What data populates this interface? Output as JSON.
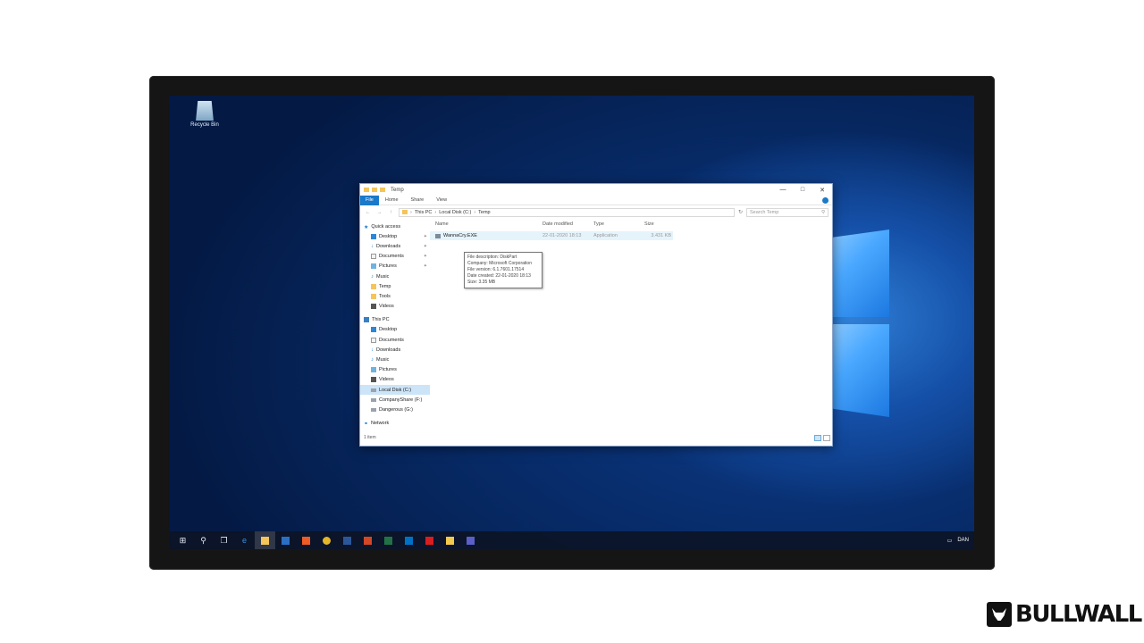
{
  "desktop": {
    "recycle_bin_label": "Recycle Bin"
  },
  "explorer": {
    "title": "Temp",
    "window_controls": {
      "minimize": "—",
      "maximize": "□",
      "close": "✕"
    },
    "ribbon": {
      "file": "File",
      "home": "Home",
      "share": "Share",
      "view": "View"
    },
    "nav_buttons": {
      "back": "←",
      "forward": "→",
      "up": "↑"
    },
    "address": {
      "this_pc": "This PC",
      "local_disk": "Local Disk (C:)",
      "temp": "Temp",
      "separator": "›"
    },
    "search_placeholder": "Search Temp",
    "nav_pane": {
      "quick_access": "Quick access",
      "quick_items": [
        "Desktop",
        "Downloads",
        "Documents",
        "Pictures",
        "Music",
        "Temp",
        "Tools",
        "Videos"
      ],
      "this_pc": "This PC",
      "pc_items": [
        "Desktop",
        "Documents",
        "Downloads",
        "Music",
        "Pictures",
        "Videos",
        "Local Disk (C:)",
        "CompanyShare (F:)",
        "Dangerous (G:)"
      ],
      "network": "Network"
    },
    "columns": {
      "name": "Name",
      "date_modified": "Date modified",
      "type": "Type",
      "size": "Size"
    },
    "files": [
      {
        "name": "WannaCry.EXE",
        "date_modified": "22-01-2020 18:13",
        "type": "Application",
        "size": "3.431 KB"
      }
    ],
    "tooltip": {
      "description": "File description: DiskPart",
      "company": "Company: Microsoft Corporation",
      "version": "File version: 6.1.7601.17514",
      "created": "Date created: 22-01-2020 18:13",
      "size": "Size: 3.35 MB"
    },
    "status": "1 item"
  },
  "taskbar": {
    "tray_text": "DAN"
  },
  "brand": {
    "name": "BULLWALL"
  },
  "colors": {
    "accent": "#1979ca",
    "selection": "#cce4f7",
    "desktop_blue": "#0d3d8c",
    "taskbar": "#0c1426"
  }
}
